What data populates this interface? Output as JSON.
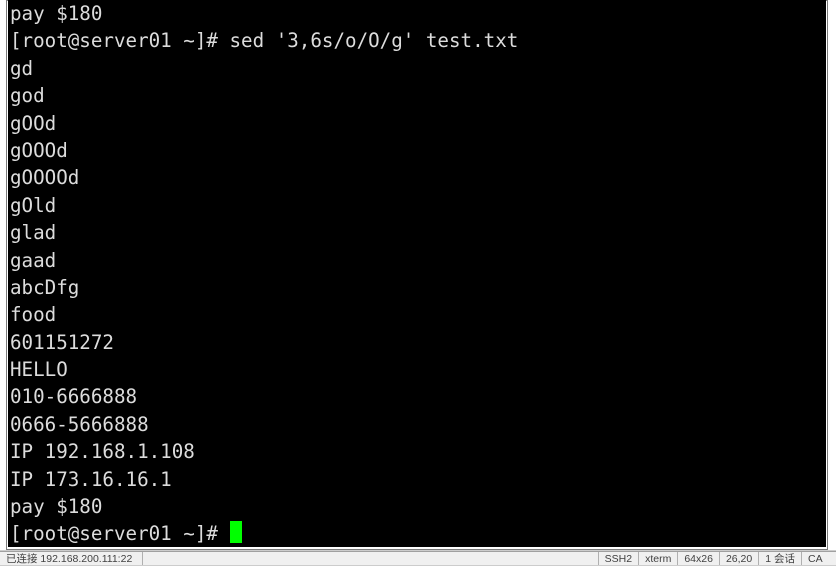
{
  "terminal": {
    "lines": [
      {
        "type": "out",
        "text": "pay $180"
      },
      {
        "type": "prompt",
        "prompt": "[root@server01 ~]# ",
        "cmd": "sed '3,6s/o/O/g' test.txt"
      },
      {
        "type": "out",
        "text": "gd"
      },
      {
        "type": "out",
        "text": "god"
      },
      {
        "type": "out",
        "text": "gOOd"
      },
      {
        "type": "out",
        "text": "gOOOd"
      },
      {
        "type": "out",
        "text": "gOOOOd"
      },
      {
        "type": "out",
        "text": "gOld"
      },
      {
        "type": "out",
        "text": "glad"
      },
      {
        "type": "out",
        "text": "gaad"
      },
      {
        "type": "out",
        "text": "abcDfg"
      },
      {
        "type": "out",
        "text": "food"
      },
      {
        "type": "out",
        "text": "601151272"
      },
      {
        "type": "out",
        "text": "HELLO"
      },
      {
        "type": "out",
        "text": "010-6666888"
      },
      {
        "type": "out",
        "text": "0666-5666888"
      },
      {
        "type": "out",
        "text": "IP 192.168.1.108"
      },
      {
        "type": "out",
        "text": "IP 173.16.16.1"
      },
      {
        "type": "out",
        "text": "pay $180"
      },
      {
        "type": "prompt",
        "prompt": "[root@server01 ~]# ",
        "cmd": "",
        "cursor": true
      }
    ]
  },
  "statusbar": {
    "left": "已连接 192.168.200.111:22",
    "proto": "SSH2",
    "term": "xterm",
    "size": "64x26",
    "pos": "26,20",
    "sess": "1 会话",
    "cap": "CA"
  }
}
